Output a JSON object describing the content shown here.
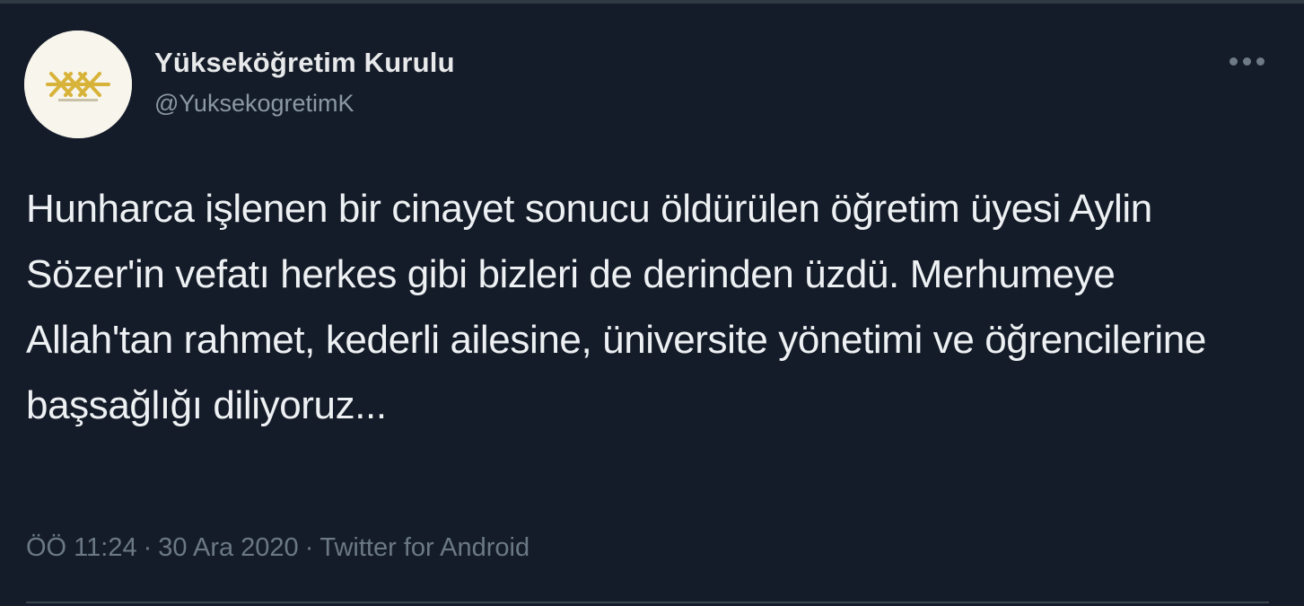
{
  "tweet": {
    "author": {
      "display_name": "Yükseköğretim Kurulu",
      "handle": "@YuksekogretimK",
      "avatar_icon": "yok-logo-icon"
    },
    "more_icon": "more-options-icon",
    "text": "Hunharca işlenen bir cinayet sonucu öldürülen öğretim üyesi Aylin Sözer'in vefatı herkes gibi bizleri de derinden üzdü. Merhumeye Allah'tan rahmet, kederli ailesine, üniversite yönetimi ve öğrencilerine başsağlığı diliyoruz...",
    "time": "ÖÖ 11:24",
    "date": "30 Ara 2020",
    "separator": "·",
    "source": "Twitter for Android"
  },
  "colors": {
    "background": "#151c29",
    "text_primary": "#eef1f3",
    "text_secondary": "#6b7886",
    "logo_gold": "#d8b33a"
  }
}
